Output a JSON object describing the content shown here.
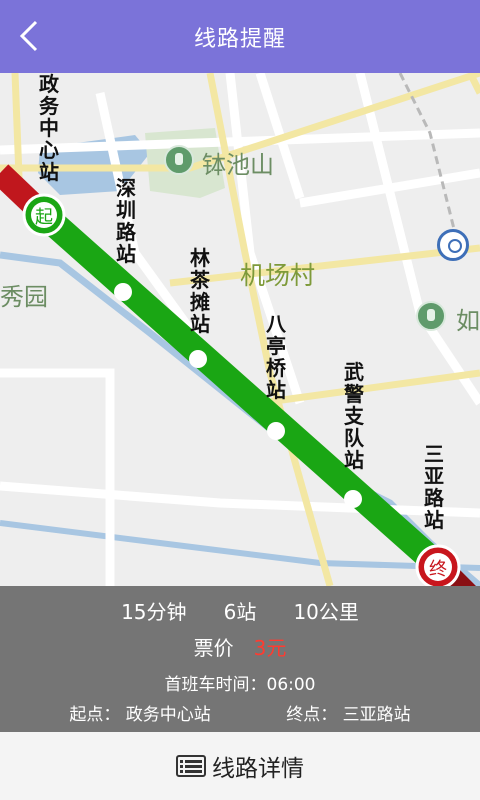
{
  "header": {
    "title": "线路提醒",
    "back_icon": "chevron-left-icon"
  },
  "map": {
    "pois": [
      "钵池山",
      "机场村",
      "秀园",
      "如"
    ],
    "stations": [
      {
        "label": "政务中心站",
        "marker": "起",
        "type": "start"
      },
      {
        "label": "深圳路站",
        "type": "stop"
      },
      {
        "label": "林茶摊站",
        "type": "stop"
      },
      {
        "label": "八亭桥站",
        "type": "stop"
      },
      {
        "label": "武警支队站",
        "type": "stop"
      },
      {
        "label": "三亚路站",
        "marker": "终",
        "type": "end"
      }
    ],
    "colors": {
      "route": "#1aa614",
      "route_outside": "#c0171d",
      "start_marker": "#1aa614",
      "end_marker": "#c8161d"
    }
  },
  "summary": {
    "duration": "15分钟",
    "stops": "6站",
    "distance": "10公里",
    "fare_label": "票价",
    "fare_value": "3元",
    "first_bus": "首班车时间：06:00",
    "start_label": "起点：",
    "start_name": "政务中心站",
    "end_label": "终点：",
    "end_name": "三亚路站"
  },
  "bottom": {
    "detail_label": "线路详情",
    "detail_icon": "list-icon"
  },
  "colors": {
    "header_bg": "#7b73d9",
    "fare_highlight": "#ff3b30"
  }
}
